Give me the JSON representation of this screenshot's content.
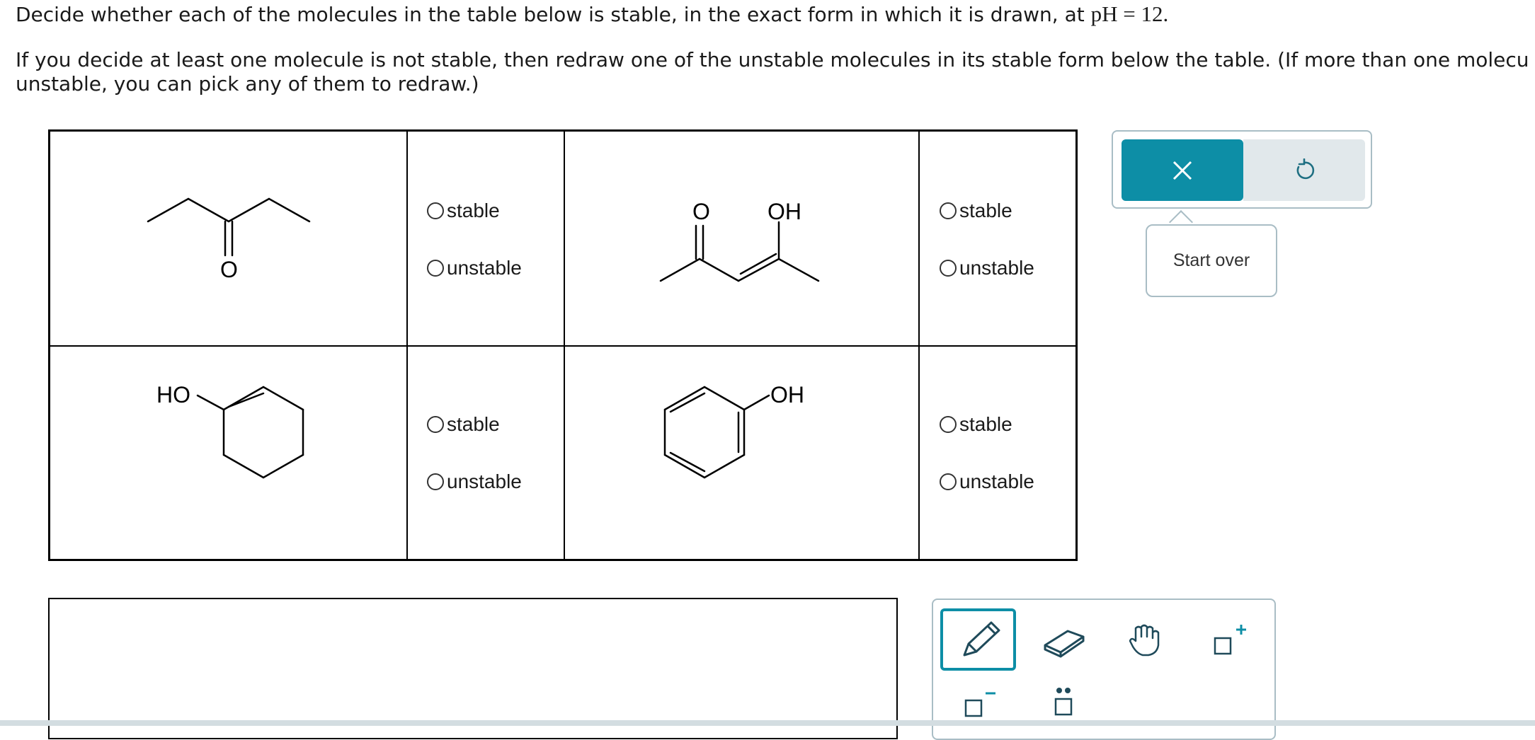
{
  "question": {
    "line1_text": "Decide whether each of the molecules in the table below is stable, in the exact form in which it is drawn, at ",
    "line1_math": "pH = 12.",
    "line2": "If you decide at least one molecule is not stable, then redraw one of the unstable molecules in its stable form below the table. (If more than one molecu",
    "line3": "unstable, you can pick any of them to redraw.)"
  },
  "molecules": [
    {
      "id": "m1",
      "labels": [
        "O"
      ],
      "options": [
        "stable",
        "unstable"
      ]
    },
    {
      "id": "m2",
      "labels": [
        "O",
        "OH"
      ],
      "options": [
        "stable",
        "unstable"
      ]
    },
    {
      "id": "m3",
      "labels": [
        "HO"
      ],
      "options": [
        "stable",
        "unstable"
      ]
    },
    {
      "id": "m4",
      "labels": [
        "OH"
      ],
      "options": [
        "stable",
        "unstable"
      ]
    }
  ],
  "actions": {
    "clear_icon": "close-icon",
    "undo_icon": "undo-icon",
    "tooltip": "Start over"
  },
  "tools": [
    "pencil-icon",
    "eraser-icon",
    "hand-icon",
    "add-charge-icon",
    "remove-charge-icon",
    "lone-pair-icon"
  ],
  "colors": {
    "accent": "#0d8ea6",
    "border": "#a9bdc5",
    "undo_bg": "#e1e8eb"
  }
}
